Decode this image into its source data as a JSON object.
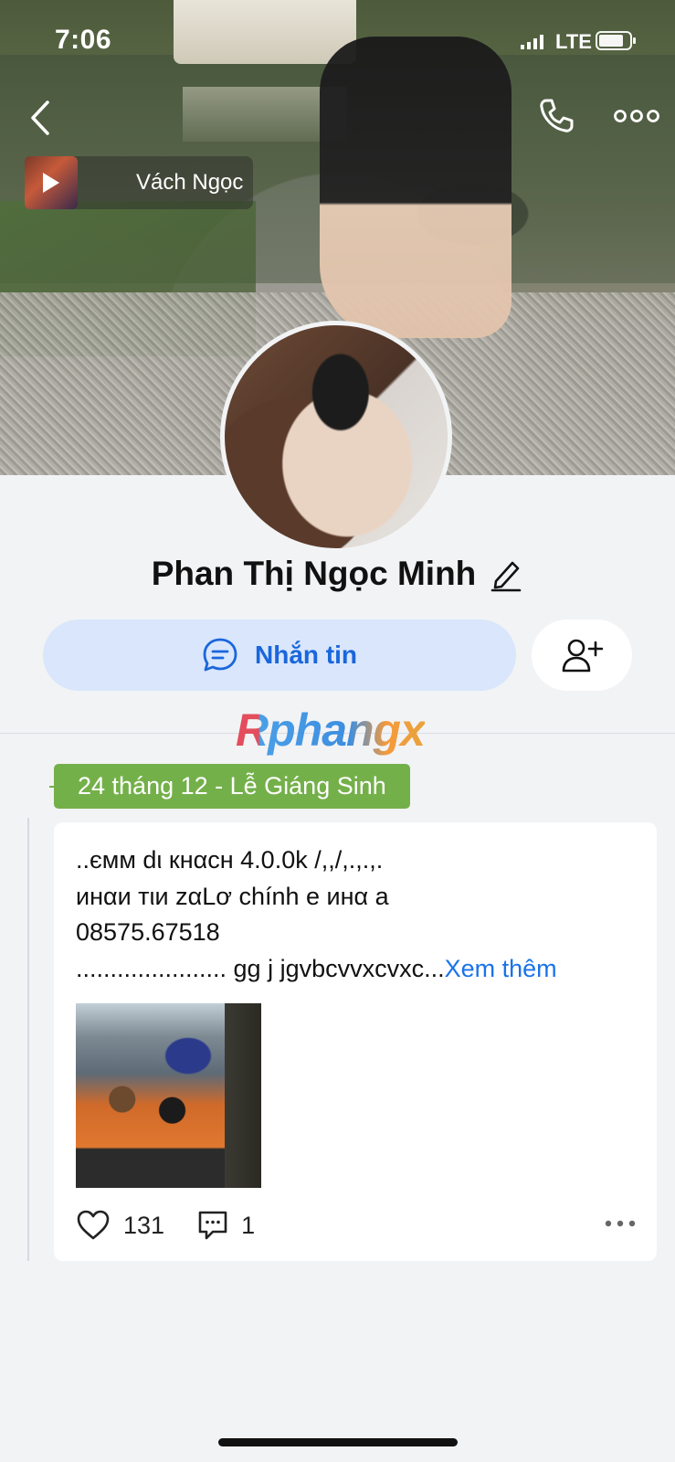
{
  "status_bar": {
    "time": "7:06",
    "network": "LTE"
  },
  "header": {
    "music": {
      "title": "Vách Ngọc"
    }
  },
  "profile": {
    "name": "Phan Thị Ngọc Minh",
    "message_button": "Nhắn tin"
  },
  "watermark": "Rphangx",
  "timeline": {
    "date_label": "24 tháng 12 - Lễ Giáng Sinh",
    "post": {
      "lines": [
        "..ємм dι кнαcн 4.0.0k /,,/,.,.,.",
        "инαи тιи zαLơ chính e инα a",
        "08575.67518",
        "...................... gg j jgvbcvvxcvxc..."
      ],
      "see_more": "Xem thêm",
      "likes": "131",
      "comments": "1"
    }
  },
  "colors": {
    "accent": "#1a66dc",
    "date_pill": "#74b04a",
    "message_button_bg": "#d9e6fc",
    "background": "#f2f3f5"
  },
  "icons": [
    "back-icon",
    "phone-icon",
    "more-icon",
    "play-icon",
    "edit-icon",
    "chat-icon",
    "add-friend-icon",
    "heart-icon",
    "comment-icon",
    "post-more-icon"
  ]
}
